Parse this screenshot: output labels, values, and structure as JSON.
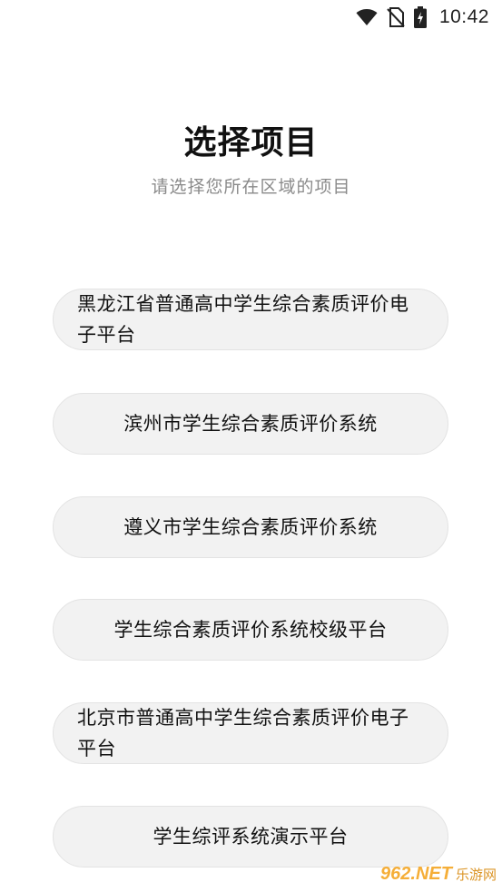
{
  "status_bar": {
    "time": "10:42",
    "icons": [
      "wifi-icon",
      "no-sim-icon",
      "battery-charging-icon"
    ]
  },
  "header": {
    "title": "选择项目",
    "subtitle": "请选择您所在区域的项目"
  },
  "projects": [
    {
      "label": "黑龙江省普通高中学生综合素质评价电子平台"
    },
    {
      "label": "滨州市学生综合素质评价系统"
    },
    {
      "label": "遵义市学生综合素质评价系统"
    },
    {
      "label": "学生综合素质评价系统校级平台"
    },
    {
      "label": "北京市普通高中学生综合素质评价电子平台"
    },
    {
      "label": "学生综评系统演示平台"
    }
  ],
  "watermark": {
    "text": "962.NET",
    "sub": "乐游网"
  },
  "colors": {
    "background": "#ffffff",
    "button_background": "#f2f2f2",
    "subtitle": "#8a8a8a"
  }
}
